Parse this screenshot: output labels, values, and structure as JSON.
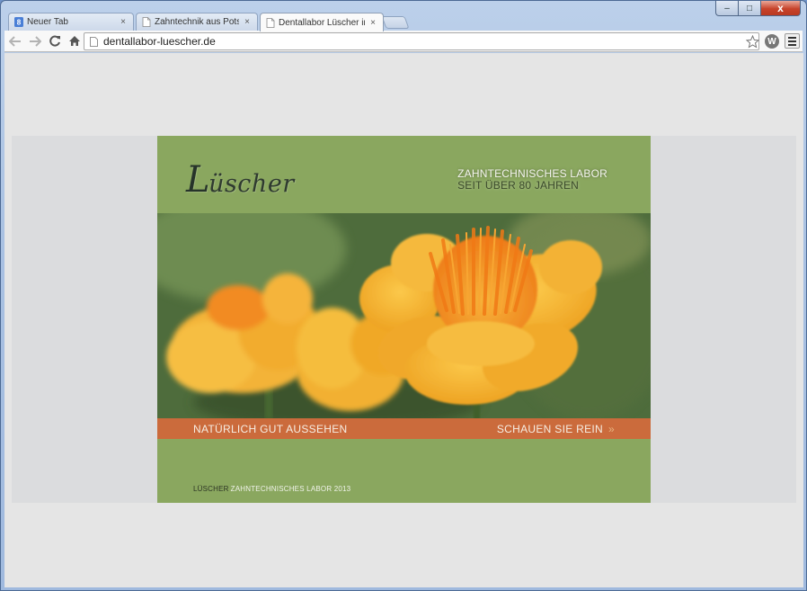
{
  "browser": {
    "tabs": [
      {
        "title": "Neuer Tab",
        "icon": "google-icon",
        "active": false
      },
      {
        "title": "Zahntechnik aus Potsdam",
        "icon": "page-icon",
        "active": false
      },
      {
        "title": "Dentallabor Lüscher in Pot",
        "icon": "page-icon",
        "active": true
      }
    ],
    "close_glyph": "×",
    "url": "dentallabor-luescher.de",
    "window_controls": {
      "minimize": "–",
      "maximize": "□",
      "close": "x"
    }
  },
  "site": {
    "logo_initial": "L",
    "logo_rest": "üscher",
    "tagline_line1": "ZAHNTECHNISCHES LABOR",
    "tagline_line2": "SEIT ÜBER 80 JAHREN",
    "banner_left": "NATÜRLICH GUT AUSSEHEN",
    "banner_right": "SCHAUEN SIE REIN",
    "banner_arrow": "»",
    "footer_brand": "LÜSCHER",
    "footer_text": "ZAHNTECHNISCHES LABOR 2013",
    "colors": {
      "header_green": "#8aa75f",
      "banner_orange": "#cb6b3c",
      "flower_yellow": "#f4b63b",
      "flower_orange": "#f08a1e"
    }
  }
}
